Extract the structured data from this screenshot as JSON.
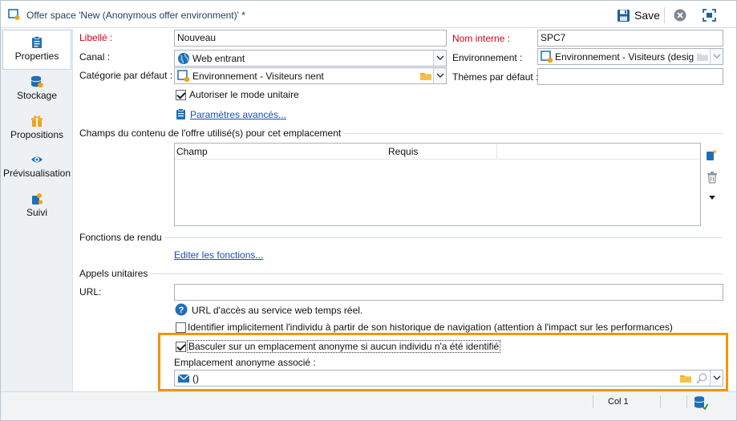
{
  "window": {
    "title": "Offer space 'New (Anonymous offer environment)' *",
    "save_label": "Save"
  },
  "sidebar": {
    "items": [
      {
        "label": "Properties",
        "icon": "clipboard-icon",
        "active": true
      },
      {
        "label": "Stockage",
        "icon": "database-sync-icon"
      },
      {
        "label": "Propositions",
        "icon": "gift-icon"
      },
      {
        "label": "Prévisualisation",
        "icon": "eye-icon"
      },
      {
        "label": "Suivi",
        "icon": "tracking-icon"
      }
    ]
  },
  "form": {
    "libelle_label": "Libellé :",
    "libelle_value": "Nouveau",
    "nom_interne_label": "Nom interne :",
    "nom_interne_value": "SPC7",
    "canal_label": "Canal :",
    "canal_value": "Web entrant",
    "environnement_label": "Environnement :",
    "environnement_value": "Environnement - Visiteurs (desig",
    "categorie_label": "Catégorie par défaut :",
    "categorie_value": "Environnement - Visiteurs nent",
    "themes_label": "Thèmes par défaut :",
    "themes_value": "",
    "mode_unitaire_label": "Autoriser le mode unitaire",
    "mode_unitaire_checked": true,
    "parametres_link": "Paramètres avancés...",
    "champs_section": "Champs du contenu de l'offre utilisé(s) pour cet emplacement",
    "table": {
      "columns": [
        "Champ",
        "Requis"
      ]
    },
    "fonctions_section": "Fonctions de rendu",
    "editer_link": "Editer les fonctions...",
    "appels_section": "Appels unitaires",
    "url_label": "URL:",
    "url_value": "",
    "url_help": "URL d'accès au service web temps réel.",
    "identifier_label": "Identifier implicitement l'individu à partir de son historique de navigation (attention à l'impact sur les performances)",
    "identifier_checked": false,
    "basculer_label": "Basculer sur un emplacement anonyme si aucun individu n'a été identifié",
    "basculer_checked": true,
    "emplacement_label": "Emplacement anonyme associé :",
    "emplacement_value": "()"
  },
  "statusbar": {
    "col_label": "Col 1"
  },
  "colors": {
    "highlight": "#f0960d",
    "required_label": "#d0021b",
    "link": "#1a4fb8",
    "accent": "#1f6fb5"
  }
}
